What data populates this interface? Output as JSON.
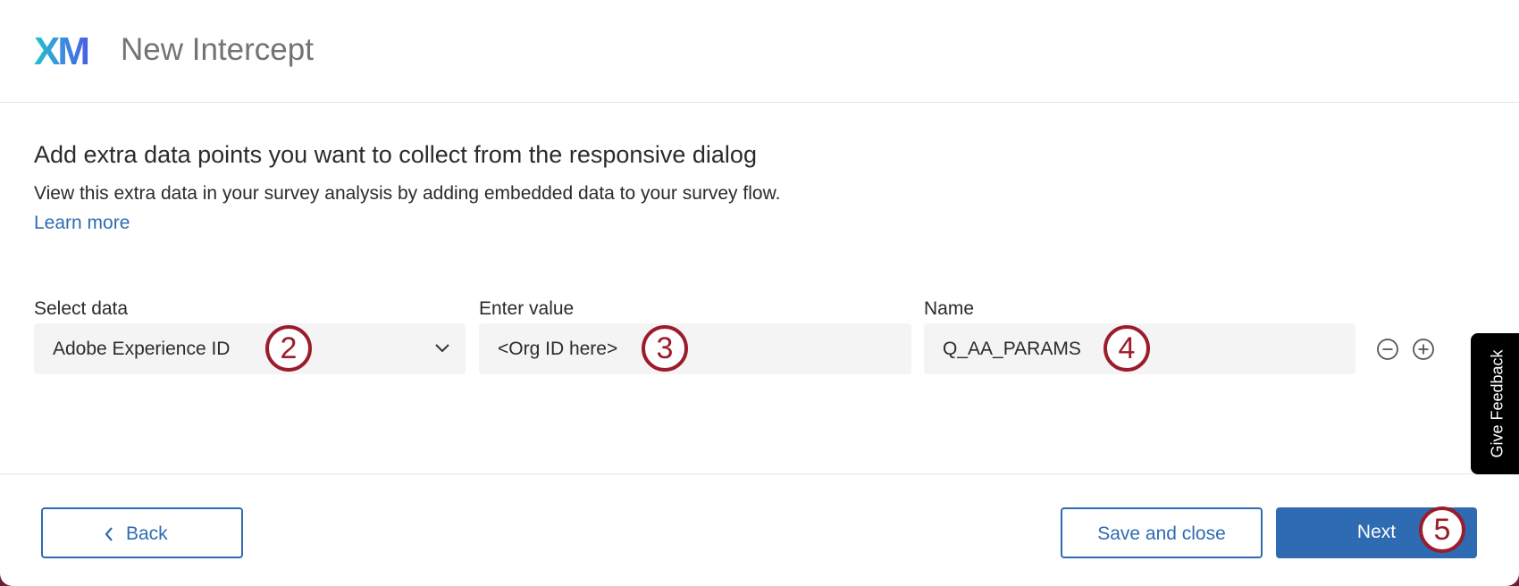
{
  "header": {
    "logo": "XM",
    "title": "New Intercept"
  },
  "content": {
    "heading": "Add extra data points you want to collect from the responsive dialog",
    "description": "View this extra data in your survey analysis by adding embedded data to your survey flow.",
    "learn_more": "Learn more"
  },
  "fields": {
    "select_data": {
      "label": "Select data",
      "value": "Adobe Experience ID"
    },
    "enter_value": {
      "label": "Enter value",
      "value": "<Org ID here>"
    },
    "name": {
      "label": "Name",
      "value": "Q_AA_PARAMS"
    }
  },
  "markers": [
    "2",
    "3",
    "4",
    "5"
  ],
  "row_actions": {
    "remove_icon": "minus-circle-icon",
    "add_icon": "plus-circle-icon"
  },
  "feedback_tab": "Give Feedback",
  "footer": {
    "back": "Back",
    "save_and_close": "Save and close",
    "next": "Next"
  },
  "colors": {
    "accent": "#2e6bb3",
    "marker": "#9b1c2a",
    "backdrop": "#6b1e3a"
  }
}
